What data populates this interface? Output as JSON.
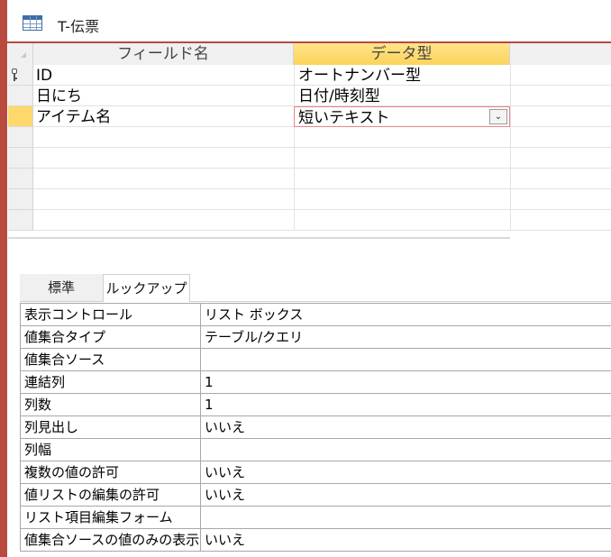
{
  "window": {
    "tab_title": "T-伝票",
    "accent_color": "#b84a3e"
  },
  "design_grid": {
    "headers": {
      "field_name": "フィールド名",
      "data_type": "データ型"
    },
    "rows": [
      {
        "field_name": "ID",
        "data_type": "オートナンバー型",
        "primary_key": true
      },
      {
        "field_name": "日にち",
        "data_type": "日付/時刻型",
        "primary_key": false
      },
      {
        "field_name": "アイテム名",
        "data_type": "短いテキスト",
        "primary_key": false,
        "selected": true
      }
    ],
    "empty_rows": 5,
    "selected_header_color": "#fcd35c"
  },
  "property_tabs": {
    "standard": "標準",
    "lookup": "ルックアップ",
    "active": "lookup"
  },
  "lookup_properties": [
    {
      "label": "表示コントロール",
      "value": "リスト ボックス"
    },
    {
      "label": "値集合タイプ",
      "value": "テーブル/クエリ"
    },
    {
      "label": "値集合ソース",
      "value": ""
    },
    {
      "label": "連結列",
      "value": "1"
    },
    {
      "label": "列数",
      "value": "1"
    },
    {
      "label": "列見出し",
      "value": "いいえ"
    },
    {
      "label": "列幅",
      "value": ""
    },
    {
      "label": "複数の値の許可",
      "value": "いいえ"
    },
    {
      "label": "値リストの編集の許可",
      "value": "いいえ"
    },
    {
      "label": "リスト項目編集フォーム",
      "value": ""
    },
    {
      "label": "値集合ソースの値のみの表示",
      "value": "いいえ"
    }
  ]
}
